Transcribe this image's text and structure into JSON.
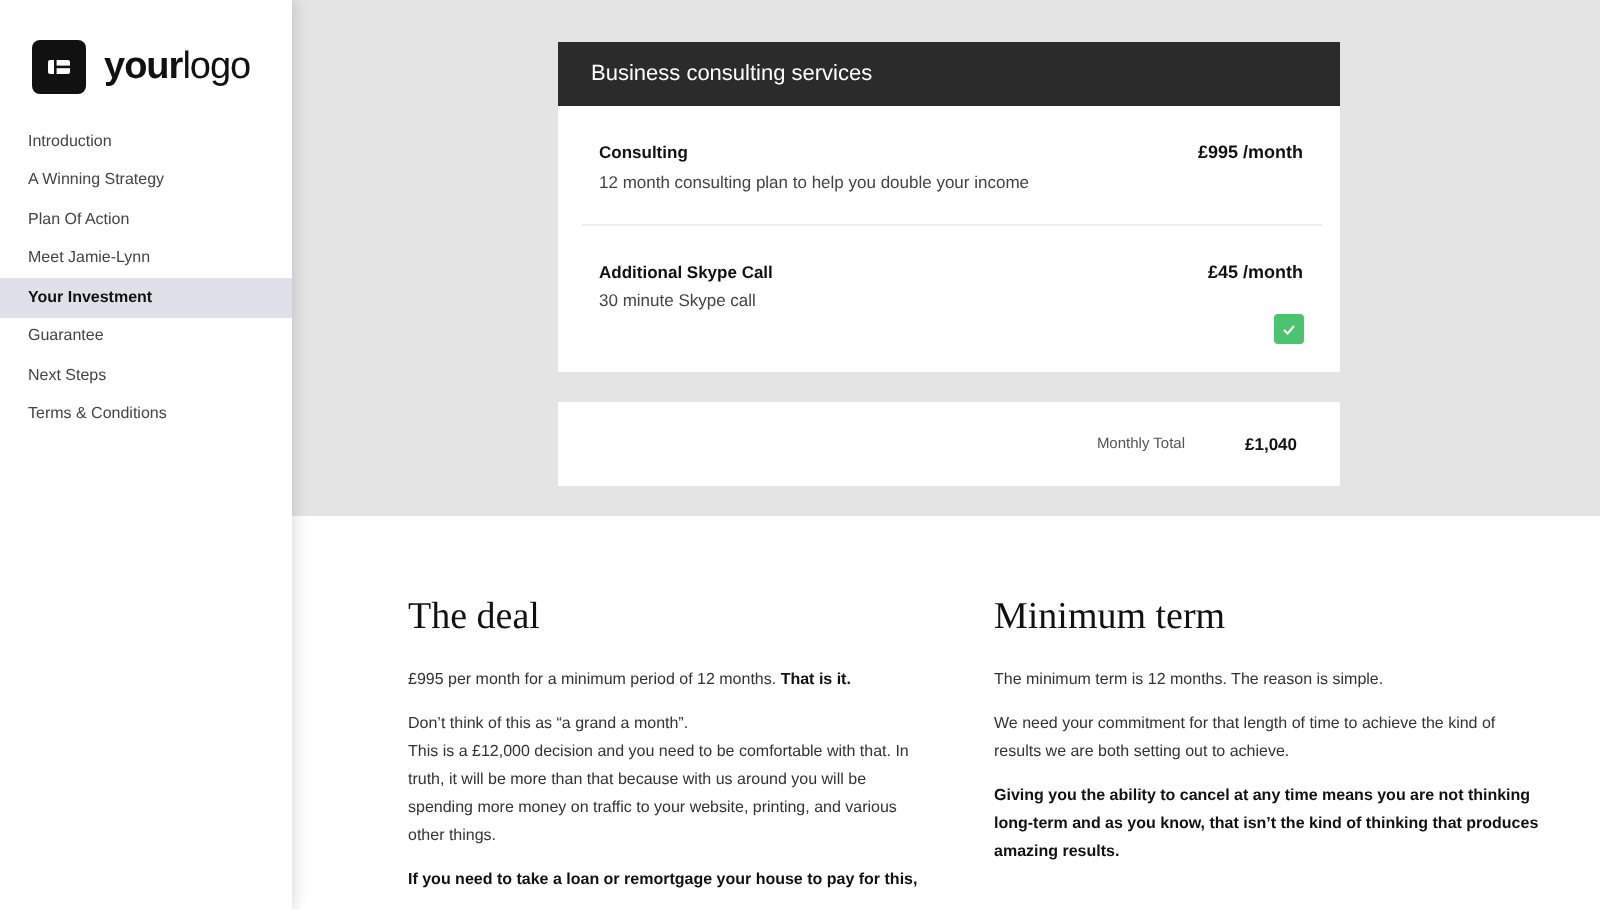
{
  "logo": {
    "text": "**your**logo"
  },
  "sidebar": {
    "items": [
      {
        "label": "Introduction",
        "selected": false
      },
      {
        "label": "A Winning Strategy",
        "selected": false
      },
      {
        "label": "Plan Of Action",
        "selected": false
      },
      {
        "label": "Meet Jamie-Lynn",
        "selected": false
      },
      {
        "label": "Your Investment",
        "selected": true
      },
      {
        "label": "Guarantee",
        "selected": false
      },
      {
        "label": "Next Steps",
        "selected": false
      },
      {
        "label": "Terms & Conditions",
        "selected": false
      }
    ]
  },
  "pricing": {
    "title": "Business consulting services",
    "items": [
      {
        "name": "Consulting",
        "description": "12 month consulting plan to help you double your income",
        "price": "£995 /month"
      },
      {
        "name": "Additional Skype Call",
        "description": "30 minute Skype call",
        "price": "£45 /month",
        "checked": true
      }
    ],
    "total_label": "Monthly Total",
    "total": "£1,040"
  },
  "columns": [
    {
      "heading": "The deal",
      "paragraphs": [
        {
          "lines": [
            "£995 per month for a minimum period of 12 months. **That is it.**"
          ]
        },
        {
          "lines": [
            "Don’t think of this as “a grand a month”.",
            "This is a £12,000 decision and you need to be comfortable with that. In truth, it will be more than that because with us around you will be spending more money on traffic to your website, printing, and various other things."
          ]
        },
        {
          "lines": [
            "**If you need to take a loan or remortgage your house to pay for this,**"
          ]
        }
      ]
    },
    {
      "heading": "Minimum term",
      "paragraphs": [
        {
          "lines": [
            "The minimum term is 12 months. The reason is simple."
          ]
        },
        {
          "lines": [
            "We need your commitment for that length of time to achieve the kind of results we are both setting out to achieve."
          ]
        },
        {
          "lines": [
            "**Giving you the ability to cancel at any time means you are not thinking long-term and as you know, that isn’t the kind of thinking that produces amazing results.**"
          ]
        }
      ]
    }
  ]
}
